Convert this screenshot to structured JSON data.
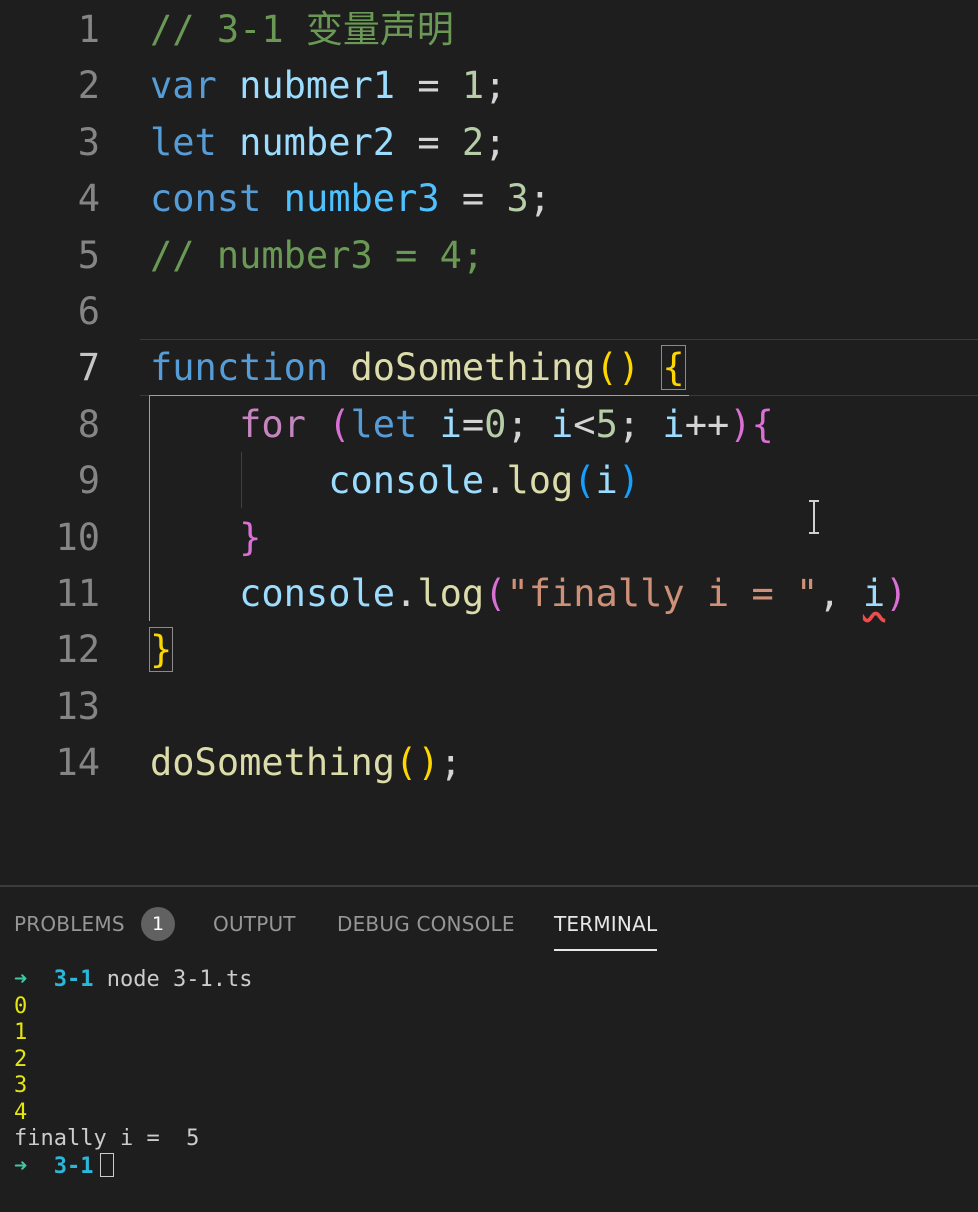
{
  "editor": {
    "lines": [
      {
        "n": "1",
        "tokens": [
          {
            "t": "// 3-1 变量声明",
            "c": "cm"
          }
        ]
      },
      {
        "n": "2",
        "tokens": [
          {
            "t": "var",
            "c": "kw"
          },
          {
            "t": " "
          },
          {
            "t": "nubmer1",
            "c": "var"
          },
          {
            "t": " = "
          },
          {
            "t": "1",
            "c": "num"
          },
          {
            "t": ";"
          }
        ]
      },
      {
        "n": "3",
        "tokens": [
          {
            "t": "let",
            "c": "kw"
          },
          {
            "t": " "
          },
          {
            "t": "number2",
            "c": "var"
          },
          {
            "t": " = "
          },
          {
            "t": "2",
            "c": "num"
          },
          {
            "t": ";"
          }
        ]
      },
      {
        "n": "4",
        "tokens": [
          {
            "t": "const",
            "c": "kw"
          },
          {
            "t": " "
          },
          {
            "t": "number3",
            "c": "const"
          },
          {
            "t": " = "
          },
          {
            "t": "3",
            "c": "num"
          },
          {
            "t": ";"
          }
        ]
      },
      {
        "n": "5",
        "tokens": [
          {
            "t": "// number3 = 4;",
            "c": "cm"
          }
        ]
      },
      {
        "n": "6",
        "tokens": []
      },
      {
        "n": "7",
        "active": true,
        "tokens": [
          {
            "t": "function",
            "c": "kw"
          },
          {
            "t": " "
          },
          {
            "t": "doSomething",
            "c": "fn"
          },
          {
            "t": "()",
            "c": "p1"
          },
          {
            "t": " "
          },
          {
            "t": "{",
            "c": "p1 bm"
          }
        ]
      },
      {
        "n": "8",
        "tokens": [
          {
            "t": "    "
          },
          {
            "t": "for",
            "c": "ctl"
          },
          {
            "t": " "
          },
          {
            "t": "(",
            "c": "p2"
          },
          {
            "t": "let",
            "c": "kw"
          },
          {
            "t": " "
          },
          {
            "t": "i",
            "c": "var"
          },
          {
            "t": "="
          },
          {
            "t": "0",
            "c": "num"
          },
          {
            "t": "; "
          },
          {
            "t": "i",
            "c": "var"
          },
          {
            "t": "<"
          },
          {
            "t": "5",
            "c": "num"
          },
          {
            "t": "; "
          },
          {
            "t": "i",
            "c": "var"
          },
          {
            "t": "++"
          },
          {
            "t": ")",
            "c": "p2"
          },
          {
            "t": "{",
            "c": "p2"
          }
        ]
      },
      {
        "n": "9",
        "tokens": [
          {
            "t": "        "
          },
          {
            "t": "console",
            "c": "var"
          },
          {
            "t": "."
          },
          {
            "t": "log",
            "c": "fn"
          },
          {
            "t": "(",
            "c": "p3"
          },
          {
            "t": "i",
            "c": "var"
          },
          {
            "t": ")",
            "c": "p3"
          }
        ]
      },
      {
        "n": "10",
        "tokens": [
          {
            "t": "    "
          },
          {
            "t": "}",
            "c": "p2"
          }
        ]
      },
      {
        "n": "11",
        "tokens": [
          {
            "t": "    "
          },
          {
            "t": "console",
            "c": "var"
          },
          {
            "t": "."
          },
          {
            "t": "log",
            "c": "fn"
          },
          {
            "t": "(",
            "c": "p2"
          },
          {
            "t": "\"finally i = \"",
            "c": "str"
          },
          {
            "t": ", "
          },
          {
            "t": "i",
            "c": "var squig"
          },
          {
            "t": ")",
            "c": "p2"
          }
        ]
      },
      {
        "n": "12",
        "tokens": [
          {
            "t": "}",
            "c": "p1 bm"
          }
        ]
      },
      {
        "n": "13",
        "tokens": []
      },
      {
        "n": "14",
        "tokens": [
          {
            "t": "doSomething",
            "c": "fn"
          },
          {
            "t": "()",
            "c": "p1"
          },
          {
            "t": ";"
          }
        ]
      }
    ]
  },
  "panel": {
    "tabs": {
      "problems": "PROBLEMS",
      "problems_count": "1",
      "output": "OUTPUT",
      "debug_console": "DEBUG CONSOLE",
      "terminal": "TERMINAL"
    },
    "terminal": {
      "prompt_arrow": "➜",
      "prompt_dir": "3-1",
      "command": "node 3-1.ts",
      "outputs": [
        "0",
        "1",
        "2",
        "3",
        "4"
      ],
      "final_line": "finally i =  5"
    }
  },
  "colors": {
    "editor_bg": "#1e1e1e",
    "keyword": "#569cd6",
    "comment": "#6a9955",
    "string": "#ce9178",
    "function": "#dcdcaa",
    "bracket_gold": "#ffd700",
    "bracket_orchid": "#da70d6",
    "bracket_blue": "#179fff",
    "terminal_arrow": "#3ec9a4",
    "terminal_dir": "#29b8db",
    "terminal_output": "#e5e510"
  }
}
